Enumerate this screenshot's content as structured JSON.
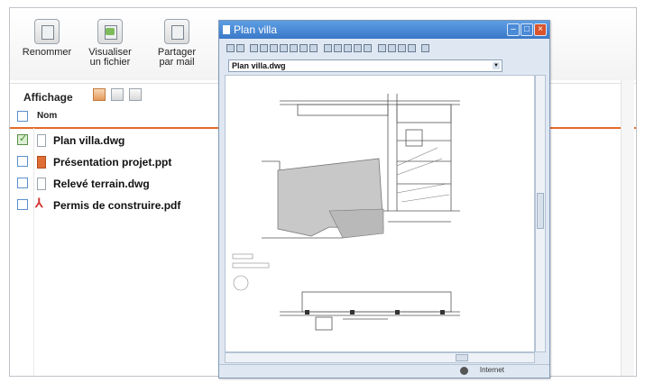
{
  "toolbar": {
    "buttons": [
      {
        "label": "Renommer",
        "icon": "rename-icon"
      },
      {
        "label": "Visualiser\nun fichier",
        "icon": "view-file-icon"
      },
      {
        "label": "Partager\npar mail",
        "icon": "share-mail-icon"
      }
    ]
  },
  "view": {
    "label": "Affichage"
  },
  "list": {
    "header": "Nom",
    "files": [
      {
        "name": "Plan villa.dwg",
        "checked": true,
        "type": "dwg"
      },
      {
        "name": "Présentation projet.ppt",
        "checked": false,
        "type": "ppt"
      },
      {
        "name": "Relevé terrain.dwg",
        "checked": false,
        "type": "dwg"
      },
      {
        "name": "Permis de construire.pdf",
        "checked": false,
        "type": "pdf"
      }
    ]
  },
  "viewer": {
    "title": "Plan villa",
    "selected_file": "Plan villa.dwg",
    "status_zone": "Internet",
    "accent": "#3a78c8"
  }
}
